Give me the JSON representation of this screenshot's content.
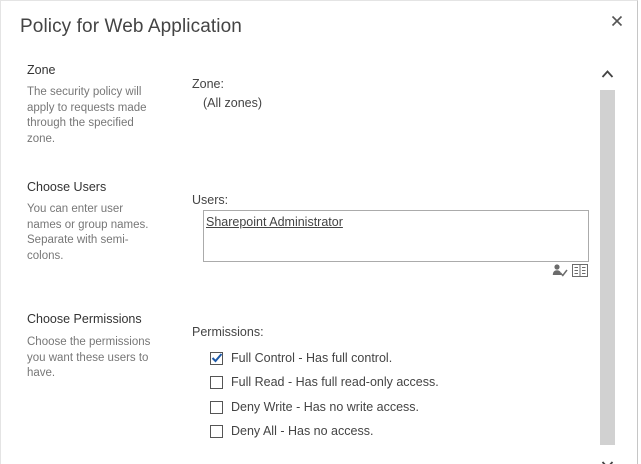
{
  "dialog": {
    "title": "Policy for Web Application"
  },
  "sections": {
    "zone": {
      "title": "Zone",
      "description": "The security policy will apply to requests made through the specified zone.",
      "field_label": "Zone:",
      "value": "(All zones)"
    },
    "users": {
      "title": "Choose Users",
      "description": "You can enter user names or group names. Separate with semi-colons.",
      "field_label": "Users:",
      "entries": [
        "Sharepoint Administrator"
      ]
    },
    "permissions": {
      "title": "Choose Permissions",
      "description": "Choose the permissions you want these users to have.",
      "field_label": "Permissions:",
      "options": [
        {
          "label": "Full Control - Has full control.",
          "checked": true
        },
        {
          "label": "Full Read - Has full read-only access.",
          "checked": false
        },
        {
          "label": "Deny Write - Has no write access.",
          "checked": false
        },
        {
          "label": "Deny All - Has no access.",
          "checked": false
        }
      ]
    }
  },
  "icons": {
    "close": "close-icon",
    "check_names": "check-names-icon",
    "browse": "address-book-icon",
    "scroll_up": "chevron-up-icon",
    "scroll_down": "chevron-down-icon",
    "checkmark": "checkmark-icon"
  },
  "colors": {
    "text": "#444444",
    "description": "#777777",
    "scroll_thumb": "#d1d1d1",
    "check_blue": "#1e5aa8"
  }
}
